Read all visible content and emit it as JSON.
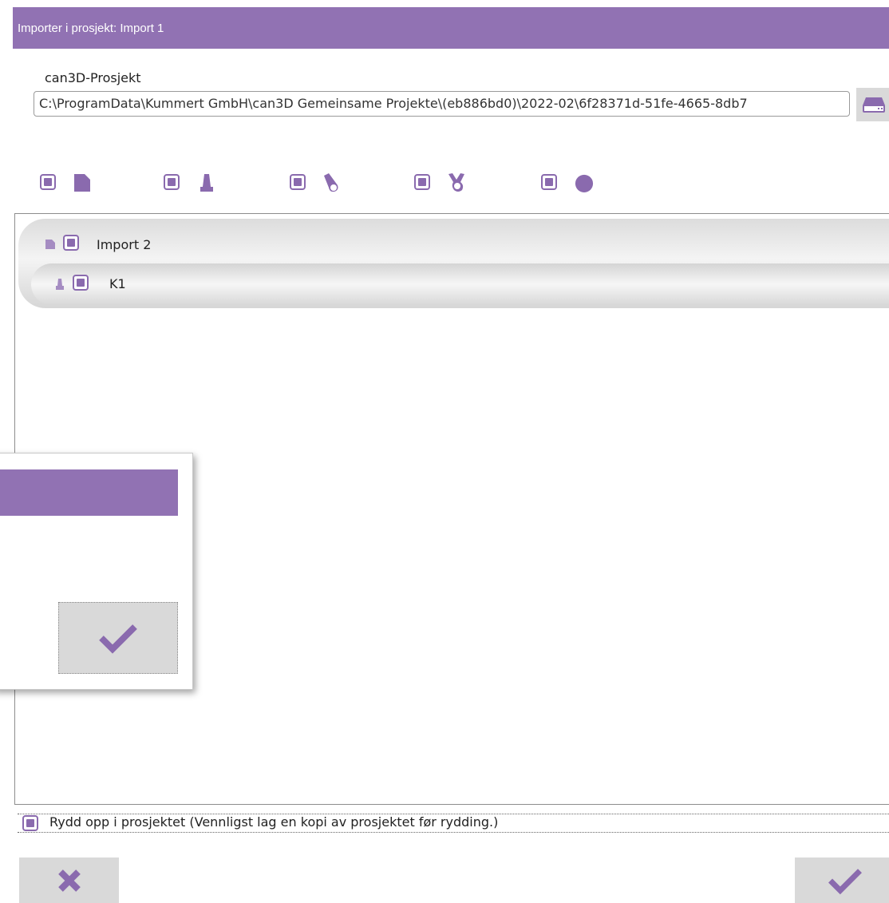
{
  "window": {
    "title": "Importer i prosjekt: Import 1"
  },
  "project": {
    "label": "can3D-Prosjekt",
    "path": "C:\\ProgramData\\Kummert GmbH\\can3D Gemeinsame Projekte\\(eb886bd0)\\2022-02\\6f28371d-51fe-4665-8db7"
  },
  "filters": [
    {
      "icon": "document-icon",
      "checked": true
    },
    {
      "icon": "manhole-icon",
      "checked": true
    },
    {
      "icon": "pipe-icon",
      "checked": true
    },
    {
      "icon": "branch-icon",
      "checked": true
    },
    {
      "icon": "circle-icon",
      "checked": true
    }
  ],
  "tree": [
    {
      "label": "Import 2",
      "icon": "document-icon",
      "checked": true
    },
    {
      "label": "K1",
      "icon": "manhole-icon",
      "checked": true
    }
  ],
  "cleanup": {
    "label": "Rydd opp i prosjektet (Vennligst lag en kopi av prosjektet før rydding.)",
    "checked": true
  },
  "buttons": {
    "cancel": "cancel-icon",
    "ok": "check-icon"
  },
  "colors": {
    "accent": "#9172b3",
    "icon": "#8a6aae",
    "button_bg": "#d9d9d9"
  }
}
